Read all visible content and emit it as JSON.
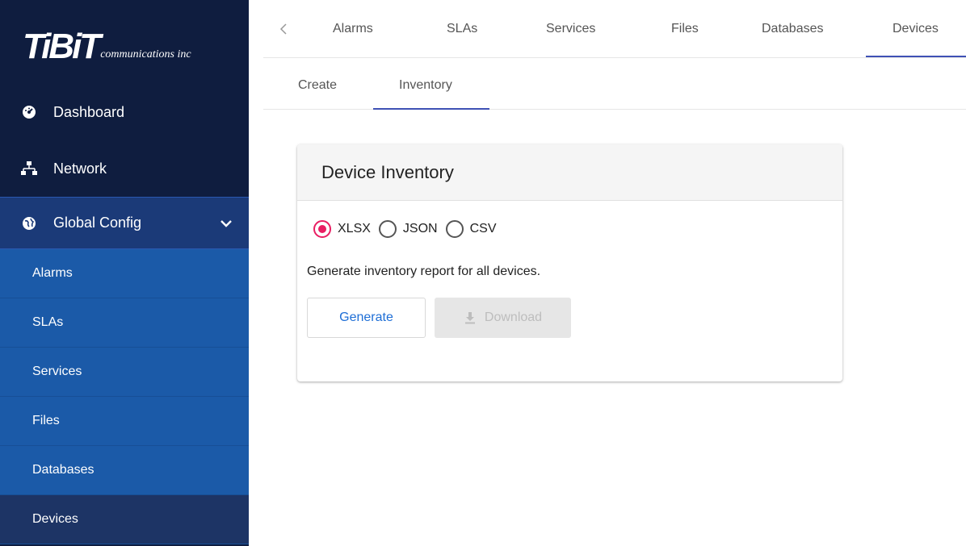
{
  "sidebar": {
    "logo": {
      "brand": "TiBiT",
      "sub": "communications inc"
    },
    "top_items": [
      {
        "label": "Dashboard",
        "icon": "dashboard-icon"
      },
      {
        "label": "Network",
        "icon": "network-icon"
      },
      {
        "label": "Global Config",
        "icon": "globe-icon"
      }
    ],
    "sub_items": [
      "Alarms",
      "SLAs",
      "Services",
      "Files",
      "Databases",
      "Devices"
    ]
  },
  "top_tabs": [
    "Alarms",
    "SLAs",
    "Services",
    "Files",
    "Databases",
    "Devices"
  ],
  "active_top_tab": "Devices",
  "sub_tabs": [
    "Create",
    "Inventory"
  ],
  "active_sub_tab": "Inventory",
  "card": {
    "title": "Device Inventory",
    "formats": [
      "XLSX",
      "JSON",
      "CSV"
    ],
    "selected_format": "XLSX",
    "description": "Generate inventory report for all devices.",
    "generate_label": "Generate",
    "download_label": "Download"
  },
  "colors": {
    "sidebar_bg": "#0f1d3f",
    "global_config_bg": "#1b3a78",
    "sub_nav_bg": "#1b5aa8",
    "sub_nav_active_bg": "#1d3465",
    "tab_indicator": "#3f51b5",
    "radio_selected": "#e91e63",
    "generate_text": "#1e6ed6"
  }
}
